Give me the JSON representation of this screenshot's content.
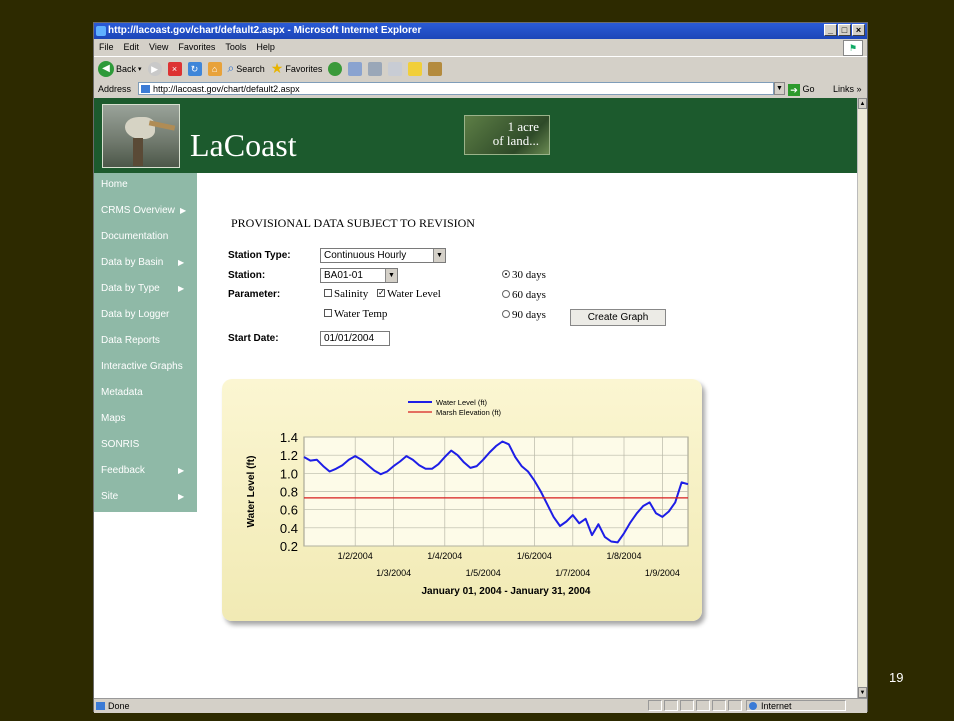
{
  "window": {
    "title": "http://lacoast.gov/chart/default2.aspx - Microsoft Internet Explorer",
    "minimize": "_",
    "maximize": "□",
    "close": "×"
  },
  "menu": [
    "File",
    "Edit",
    "View",
    "Favorites",
    "Tools",
    "Help"
  ],
  "toolbar": {
    "back": "Back",
    "search": "Search",
    "favorites": "Favorites"
  },
  "address": {
    "label": "Address",
    "url": "http://lacoast.gov/chart/default2.aspx",
    "go": "Go",
    "links": "Links"
  },
  "banner": {
    "logo": "LaCoast",
    "tagline_1": "1 acre",
    "tagline_2": "of land..."
  },
  "sidebar": [
    "Home",
    "CRMS Overview",
    "Documentation",
    "Data by Basin",
    "Data by Type",
    "Data by Logger",
    "Data Reports",
    "Interactive Graphs",
    "Metadata",
    "Maps",
    "SONRIS",
    "Feedback",
    "Site"
  ],
  "form": {
    "heading": "PROVISIONAL DATA SUBJECT TO REVISION",
    "station_type_label": "Station Type:",
    "station_type_value": "Continuous Hourly",
    "station_label": "Station:",
    "station_value": "BA01-01",
    "parameter_label": "Parameter:",
    "param_salinity": "Salinity",
    "param_water_level": "Water Level",
    "param_water_temp": "Water Temp",
    "range_30": "30 days",
    "range_60": "60 days",
    "range_90": "90 days",
    "selected_range": "30 days",
    "create_button": "Create Graph",
    "start_date_label": "Start Date:",
    "start_date_value": "01/01/2004"
  },
  "status": {
    "text": "Done",
    "zone": "Internet"
  },
  "slide_number": "19",
  "colors": {
    "water_level": "#1e1ee6",
    "marsh": "#d81e1e",
    "banner": "#1c5a2d",
    "sidebar": "#8fb9a7"
  },
  "chart_data": {
    "type": "line",
    "title": "January 01, 2004 - January 31, 2004",
    "ylabel": "Water Level (ft)",
    "xlabel": "January 01, 2004 - January 31, 2004",
    "ylim": [
      0.2,
      1.4
    ],
    "xlim": [
      1,
      31
    ],
    "yticks": [
      "1.4",
      "1.2",
      "1.0",
      "0.8",
      "0.6",
      "0.4",
      "0.2"
    ],
    "yticks_values": [
      1.4,
      1.2,
      1.0,
      0.8,
      0.6,
      0.4,
      0.2
    ],
    "xticks": [
      {
        "label": "1/2/2004",
        "day": 5
      },
      {
        "label": "1/3/2004",
        "day": 8
      },
      {
        "label": "1/4/2004",
        "day": 12
      },
      {
        "label": "1/5/2004",
        "day": 15
      },
      {
        "label": "1/6/2004",
        "day": 19
      },
      {
        "label": "1/7/2004",
        "day": 22
      },
      {
        "label": "1/8/2004",
        "day": 26
      },
      {
        "label": "1/9/2004",
        "day": 29
      }
    ],
    "legend": [
      "Water Level (ft)",
      "Marsh Elevation (ft)"
    ],
    "legend_position": "top-center",
    "grid": true,
    "series": [
      {
        "name": "Water Level (ft)",
        "x": [
          1,
          1.5,
          2,
          2.5,
          3,
          3.5,
          4,
          4.5,
          5,
          5.5,
          6,
          6.5,
          7,
          7.5,
          8,
          8.5,
          9,
          9.5,
          10,
          10.5,
          11,
          11.5,
          12,
          12.5,
          13,
          13.5,
          14,
          14.5,
          15,
          15.5,
          16,
          16.5,
          17,
          17.5,
          18,
          18.5,
          19,
          19.5,
          20,
          20.5,
          21,
          21.5,
          22,
          22.5,
          23,
          23.5,
          24,
          24.5,
          25,
          25.5,
          26,
          26.5,
          27,
          27.5,
          28,
          28.5,
          29,
          29.5,
          30,
          30.5,
          31
        ],
        "y": [
          1.18,
          1.14,
          1.15,
          1.08,
          1.02,
          1.05,
          1.09,
          1.15,
          1.19,
          1.15,
          1.09,
          1.03,
          0.99,
          1.02,
          1.08,
          1.13,
          1.19,
          1.15,
          1.09,
          1.05,
          1.05,
          1.1,
          1.18,
          1.25,
          1.2,
          1.12,
          1.06,
          1.08,
          1.15,
          1.23,
          1.3,
          1.35,
          1.32,
          1.18,
          1.08,
          1.02,
          0.92,
          0.8,
          0.66,
          0.52,
          0.42,
          0.47,
          0.54,
          0.45,
          0.5,
          0.32,
          0.44,
          0.3,
          0.25,
          0.24,
          0.34,
          0.46,
          0.56,
          0.64,
          0.68,
          0.56,
          0.52,
          0.58,
          0.68,
          0.9,
          0.88
        ]
      },
      {
        "name": "Marsh Elevation (ft)",
        "x": [
          1,
          31
        ],
        "y": [
          0.73,
          0.73
        ]
      }
    ]
  }
}
